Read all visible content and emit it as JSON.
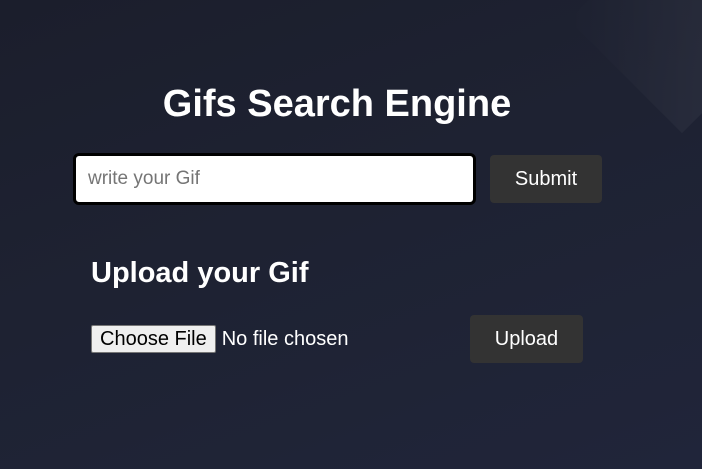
{
  "header": {
    "title": "Gifs Search Engine"
  },
  "search": {
    "placeholder": "write your Gif",
    "value": "",
    "submit_label": "Submit"
  },
  "upload": {
    "heading": "Upload your Gif",
    "choose_file_label": "Choose File",
    "file_status": "No file chosen",
    "upload_label": "Upload"
  },
  "theme": {
    "background": "#1e2232",
    "button": "#333333",
    "text": "#ffffff"
  }
}
